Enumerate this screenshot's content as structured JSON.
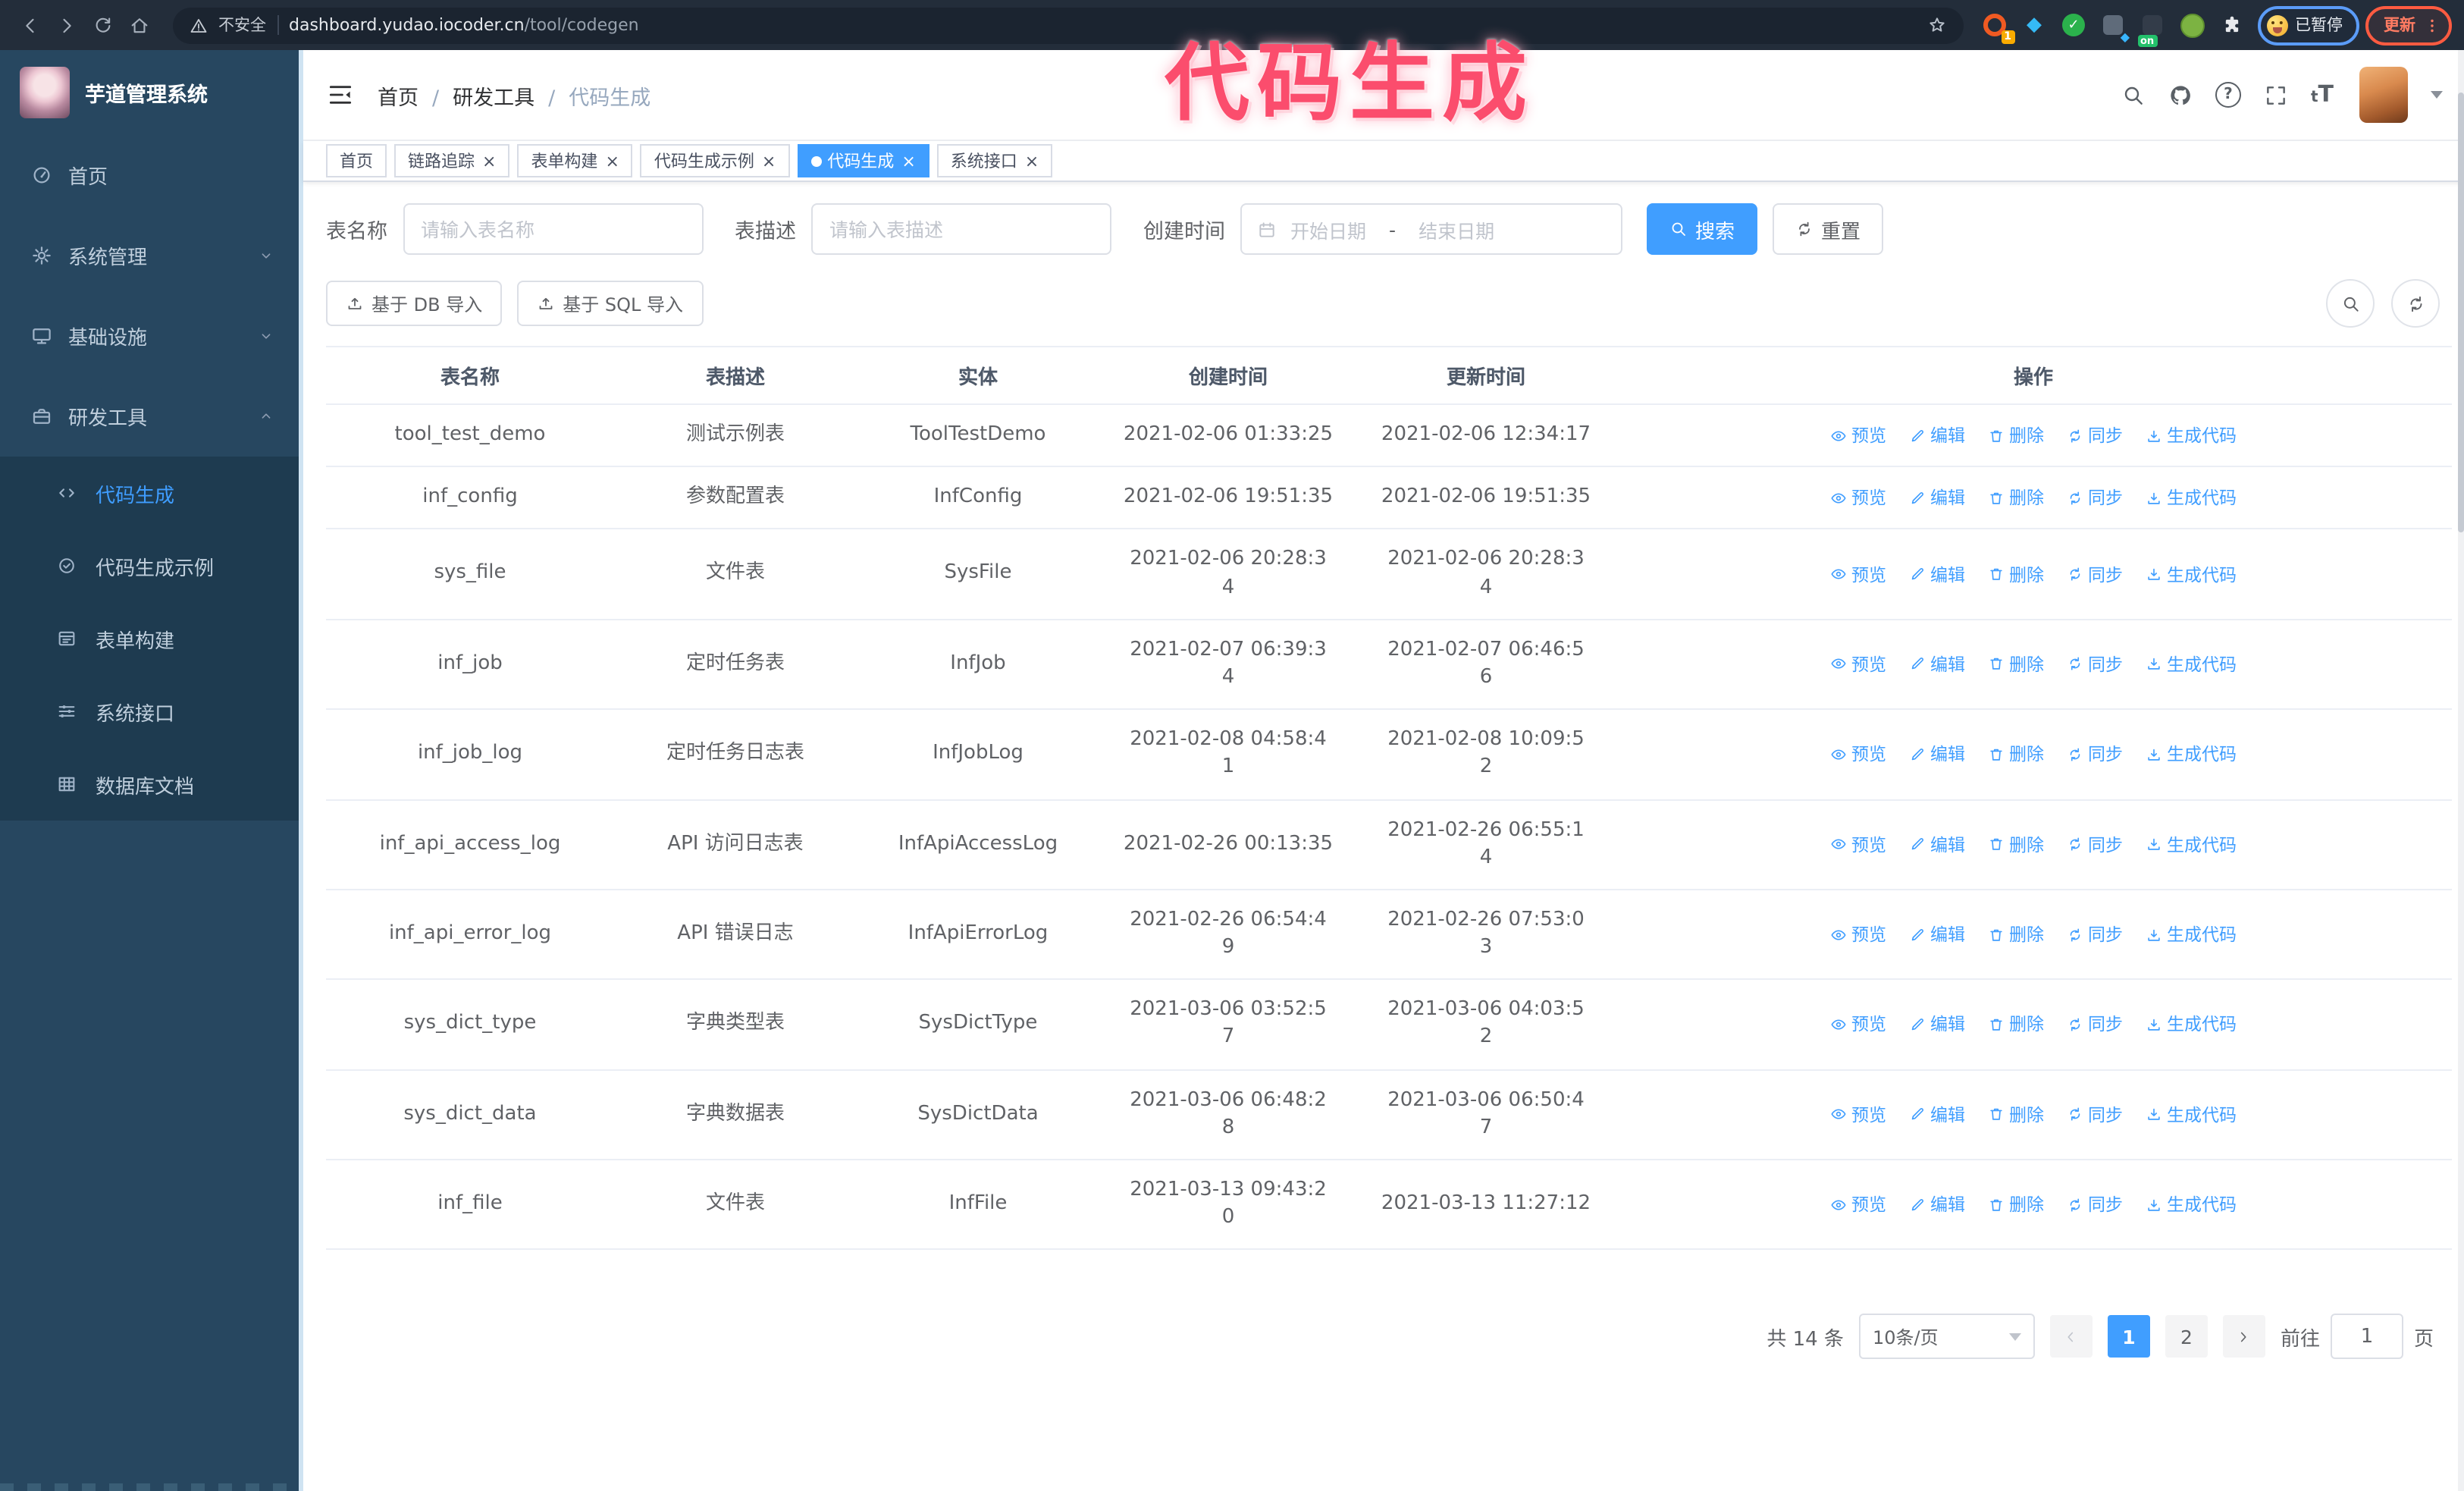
{
  "browser": {
    "security_label": "不安全",
    "url_host": "dashboard.yudao.iocoder.cn",
    "url_path": "/tool/codegen",
    "extension_badge_1": "1",
    "extension_badge_on": "on",
    "profile_label": "已暂停",
    "update_label": "更新"
  },
  "annotation": {
    "text": "代码生成",
    "color": "#fb4d6d"
  },
  "sidebar": {
    "title": "芋道管理系统",
    "items": [
      {
        "label": "首页",
        "icon": "dashboard-icon"
      },
      {
        "label": "系统管理",
        "icon": "gear-icon",
        "chevron": "down"
      },
      {
        "label": "基础设施",
        "icon": "monitor-icon",
        "chevron": "down"
      },
      {
        "label": "研发工具",
        "icon": "toolbox-icon",
        "chevron": "up",
        "expanded": true
      }
    ],
    "submenu": [
      {
        "label": "代码生成",
        "icon": "code-icon",
        "active": true
      },
      {
        "label": "代码生成示例",
        "icon": "badge-check-icon"
      },
      {
        "label": "表单构建",
        "icon": "form-icon"
      },
      {
        "label": "系统接口",
        "icon": "sliders-icon"
      },
      {
        "label": "数据库文档",
        "icon": "table-grid-icon"
      }
    ]
  },
  "header": {
    "breadcrumb": [
      "首页",
      "研发工具",
      "代码生成"
    ],
    "tools": [
      "search-icon",
      "github-icon",
      "help-icon",
      "fullscreen-icon",
      "font-size-icon",
      "avatar",
      "caret-down-icon"
    ]
  },
  "tabs": [
    {
      "label": "首页",
      "closable": false,
      "active": false
    },
    {
      "label": "链路追踪",
      "closable": true,
      "active": false
    },
    {
      "label": "表单构建",
      "closable": true,
      "active": false
    },
    {
      "label": "代码生成示例",
      "closable": true,
      "active": false
    },
    {
      "label": "代码生成",
      "closable": true,
      "active": true
    },
    {
      "label": "系统接口",
      "closable": true,
      "active": false
    }
  ],
  "search_form": {
    "name_label": "表名称",
    "name_placeholder": "请输入表名称",
    "desc_label": "表描述",
    "desc_placeholder": "请输入表描述",
    "time_label": "创建时间",
    "start_placeholder": "开始日期",
    "range_separator": "-",
    "end_placeholder": "结束日期",
    "search_label": "搜索",
    "reset_label": "重置"
  },
  "toolbar": {
    "import_db_label": "基于 DB 导入",
    "import_sql_label": "基于 SQL 导入"
  },
  "table": {
    "columns": [
      "表名称",
      "表描述",
      "实体",
      "创建时间",
      "更新时间",
      "操作"
    ],
    "actions": [
      {
        "label": "预览",
        "icon": "eye-icon"
      },
      {
        "label": "编辑",
        "icon": "edit-icon"
      },
      {
        "label": "删除",
        "icon": "trash-icon"
      },
      {
        "label": "同步",
        "icon": "sync-icon"
      },
      {
        "label": "生成代码",
        "icon": "download-icon"
      }
    ],
    "rows": [
      {
        "name": "tool_test_demo",
        "desc": "测试示例表",
        "entity": "ToolTestDemo",
        "created": "2021-02-06 01:33:25",
        "updated": "2021-02-06 12:34:17"
      },
      {
        "name": "inf_config",
        "desc": "参数配置表",
        "entity": "InfConfig",
        "created": "2021-02-06 19:51:35",
        "updated": "2021-02-06 19:51:35"
      },
      {
        "name": "sys_file",
        "desc": "文件表",
        "entity": "SysFile",
        "created": "2021-02-06 20:28:3\n4",
        "updated": "2021-02-06 20:28:3\n4"
      },
      {
        "name": "inf_job",
        "desc": "定时任务表",
        "entity": "InfJob",
        "created": "2021-02-07 06:39:3\n4",
        "updated": "2021-02-07 06:46:5\n6"
      },
      {
        "name": "inf_job_log",
        "desc": "定时任务日志表",
        "entity": "InfJobLog",
        "created": "2021-02-08 04:58:4\n1",
        "updated": "2021-02-08 10:09:5\n2"
      },
      {
        "name": "inf_api_access_log",
        "desc": "API 访问日志表",
        "entity": "InfApiAccessLog",
        "created": "2021-02-26 00:13:35",
        "updated": "2021-02-26 06:55:1\n4"
      },
      {
        "name": "inf_api_error_log",
        "desc": "API 错误日志",
        "entity": "InfApiErrorLog",
        "created": "2021-02-26 06:54:4\n9",
        "updated": "2021-02-26 07:53:0\n3"
      },
      {
        "name": "sys_dict_type",
        "desc": "字典类型表",
        "entity": "SysDictType",
        "created": "2021-03-06 03:52:5\n7",
        "updated": "2021-03-06 04:03:5\n2"
      },
      {
        "name": "sys_dict_data",
        "desc": "字典数据表",
        "entity": "SysDictData",
        "created": "2021-03-06 06:48:2\n8",
        "updated": "2021-03-06 06:50:4\n7"
      },
      {
        "name": "inf_file",
        "desc": "文件表",
        "entity": "InfFile",
        "created": "2021-03-13 09:43:2\n0",
        "updated": "2021-03-13 11:27:12"
      }
    ]
  },
  "pagination": {
    "total": "共 14 条",
    "page_size": "10条/页",
    "pages": [
      "1",
      "2"
    ],
    "current": "1",
    "goto_label": "前往",
    "goto_value": "1",
    "unit": "页"
  },
  "colors": {
    "accent": "#409eff",
    "annotation": "#fb4d6d",
    "sidebar_bg": "#274760",
    "submenu_bg": "#1e3b50",
    "browser_bar_bg": "#232d3a"
  }
}
